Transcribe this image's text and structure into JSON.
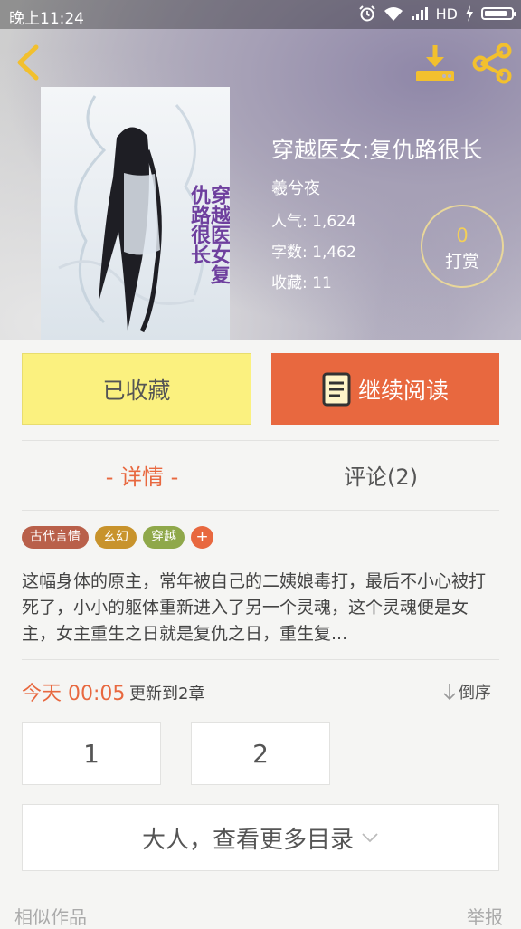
{
  "status_bar": {
    "time": "晚上11:24",
    "network": "HD"
  },
  "book": {
    "cover_title": "穿越医女复仇路很长",
    "title": "穿越医女:复仇路很长",
    "author": "羲兮夜",
    "popularity": "人气: 1,624",
    "word_count": "字数: 1,462",
    "favorites": "收藏: 11"
  },
  "reward": {
    "count": "0",
    "label": "打赏"
  },
  "actions": {
    "collected_label": "已收藏",
    "read_label": "继续阅读"
  },
  "tabs": {
    "detail": "- 详情 -",
    "comments": "评论(2)"
  },
  "tags": [
    {
      "label": "古代言情",
      "color": "#b9604a"
    },
    {
      "label": "玄幻",
      "color": "#c8932c"
    },
    {
      "label": "穿越",
      "color": "#8fa84a"
    }
  ],
  "add_tag": "+",
  "description": "这幅身体的原主，常年被自己的二姨娘毒打，最后不小心被打死了，小小的躯体重新进入了另一个灵魂，这个灵魂便是女主，女主重生之日就是复仇之日，重生复...",
  "update": {
    "time": "今天 00:05",
    "text": "更新到2章",
    "sort": "倒序"
  },
  "chapters": [
    "1",
    "2"
  ],
  "more_catalog": "大人，查看更多目录",
  "footer": {
    "similar": "相似作品",
    "report": "举报"
  },
  "colors": {
    "accent": "#e8683f",
    "collected_bg": "#fbf17f",
    "reward_count": "#f3cf58"
  }
}
